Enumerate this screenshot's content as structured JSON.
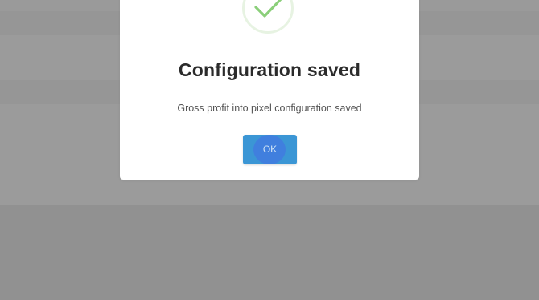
{
  "dialog": {
    "title": "Configuration saved",
    "message": "Gross profit into pixel configuration saved",
    "ok_label": "OK",
    "icon": "checkmark-icon"
  },
  "colors": {
    "overlay": "#939393",
    "dialog_background": "#ffffff",
    "success_green": "#8bcf7a",
    "success_ring": "#e7f3e2",
    "button_blue": "#3b96d5",
    "title_text": "#2b2b2b"
  }
}
